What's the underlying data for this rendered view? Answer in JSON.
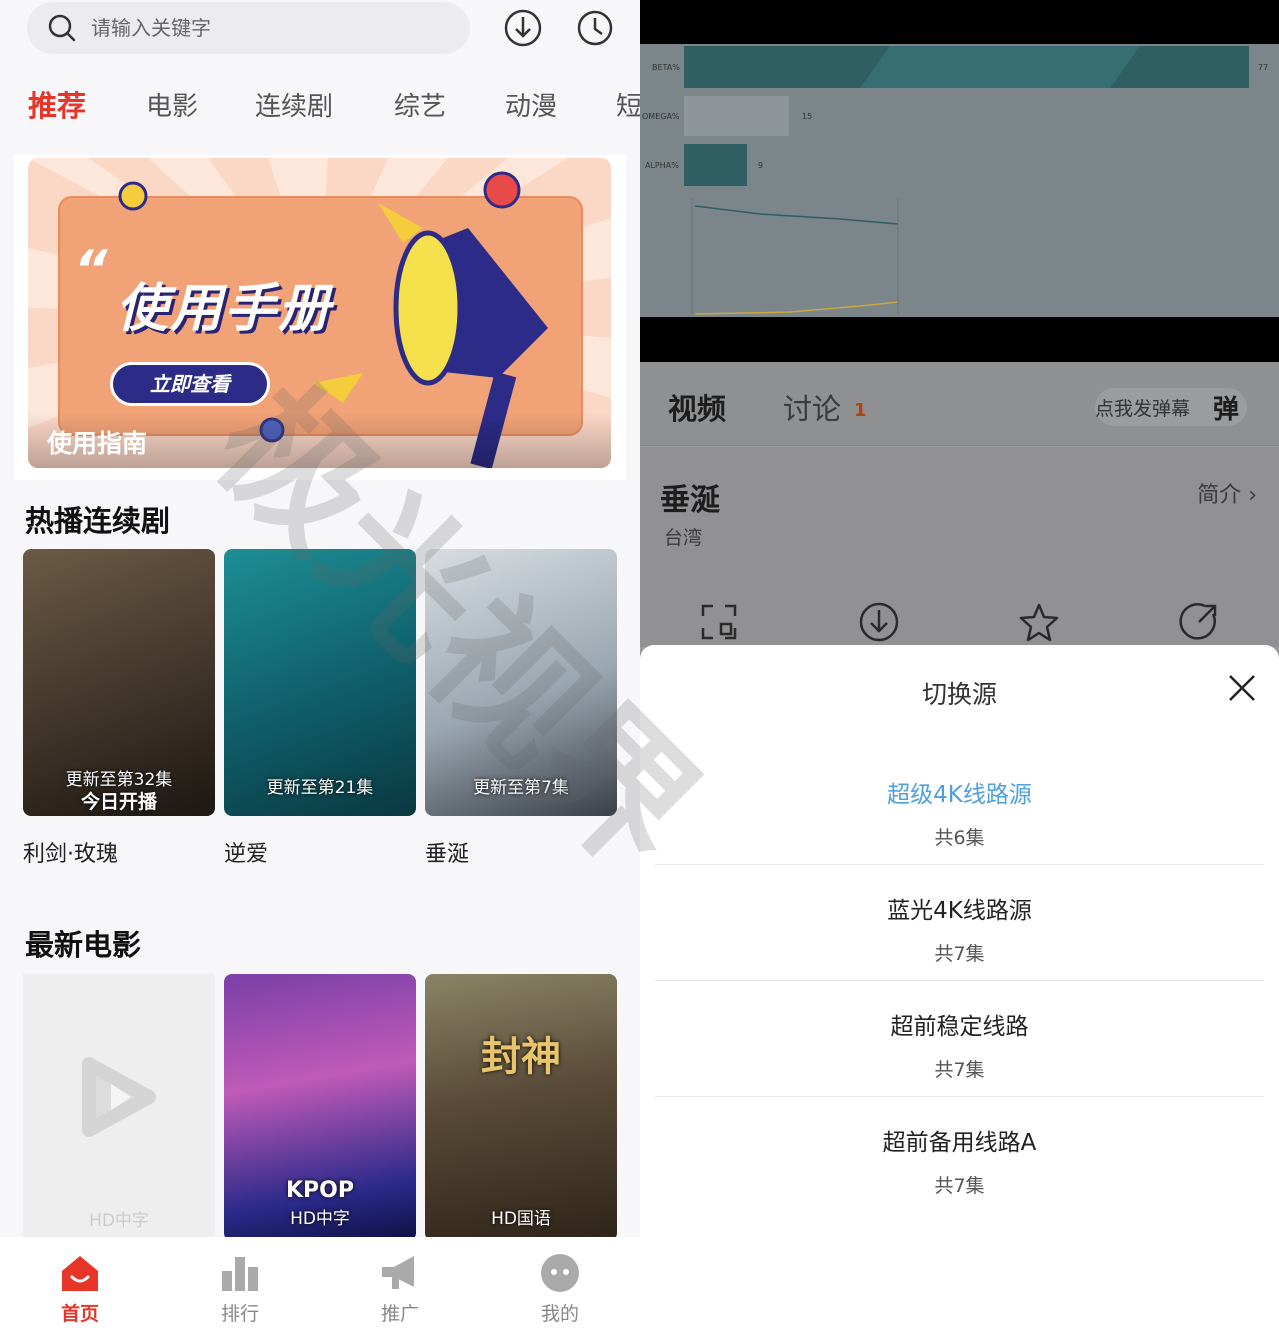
{
  "left": {
    "search": {
      "placeholder": "请输入关键字"
    },
    "tabs": [
      "推荐",
      "电影",
      "连续剧",
      "综艺",
      "动漫",
      "短"
    ],
    "banner": {
      "quote": "“",
      "title": "使用手册",
      "button": "立即查看",
      "caption": "使用指南"
    },
    "sections": {
      "hot_series": {
        "title": "热播连续剧",
        "items": [
          {
            "title": "利剑·玫瑰",
            "overlay": "更新至第32集",
            "overlay2": "今日开播"
          },
          {
            "title": "逆爱",
            "overlay": "更新至第21集"
          },
          {
            "title": "垂涎",
            "overlay": "更新至第7集"
          }
        ]
      },
      "new_movies": {
        "title": "最新电影",
        "items": [
          {
            "overlay": "HD中字"
          },
          {
            "overlay": "HD中字",
            "poster_text": "KPOP"
          },
          {
            "overlay": "HD国语",
            "poster_text": "封神"
          }
        ]
      }
    },
    "bottom_nav": [
      "首页",
      "排行",
      "推广",
      "我的"
    ]
  },
  "right": {
    "chart_labels": [
      "BETA%",
      "OMEGA%",
      "ALPHA%"
    ],
    "chart_values": [
      "77",
      "15",
      "9"
    ],
    "tabs": {
      "video": "视频",
      "discussion": "讨论",
      "discussion_count": "1"
    },
    "danmu": {
      "label": "点我发弹幕",
      "icon": "弹"
    },
    "show": {
      "title": "垂涎",
      "region": "台湾",
      "intro": "简介 ›"
    },
    "sheet": {
      "title": "切换源",
      "sources": [
        {
          "name": "超级4K线路源",
          "count": "共6集"
        },
        {
          "name": "蓝光4K线路源",
          "count": "共7集"
        },
        {
          "name": "超前稳定线路",
          "count": "共7集"
        },
        {
          "name": "超前备用线路A",
          "count": "共7集"
        }
      ]
    }
  },
  "watermark": "极光视界",
  "colors": {
    "accent": "#e8352a",
    "active_source": "#4e9fe0"
  }
}
